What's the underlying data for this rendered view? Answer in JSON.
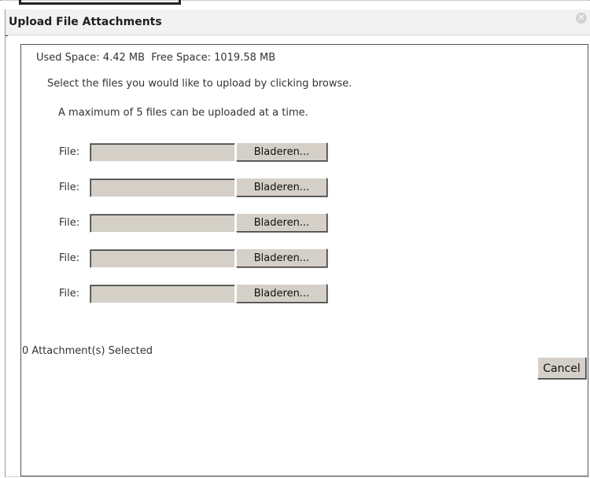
{
  "dialog": {
    "title": "Upload File Attachments",
    "close_icon": "close-circle-icon"
  },
  "quota": {
    "text": "Used Space: 4.42 MB  Free Space: 1019.58 MB"
  },
  "instructions": {
    "line1": "Select the files you would like to upload by clicking browse.",
    "line2": "A maximum of 5 files can be uploaded at a time."
  },
  "file_rows": [
    {
      "label": "File:",
      "value": "",
      "button": "Bladeren..."
    },
    {
      "label": "File:",
      "value": "",
      "button": "Bladeren..."
    },
    {
      "label": "File:",
      "value": "",
      "button": "Bladeren..."
    },
    {
      "label": "File:",
      "value": "",
      "button": "Bladeren..."
    },
    {
      "label": "File:",
      "value": "",
      "button": "Bladeren..."
    }
  ],
  "status": {
    "selected": "0 Attachment(s) Selected"
  },
  "actions": {
    "cancel_label": "Cancel"
  },
  "colors": {
    "dialog_border": "#999999",
    "content_border": "#555555",
    "control_face": "#d4d0c8",
    "titlebar_bg": "#f2f2f2"
  }
}
